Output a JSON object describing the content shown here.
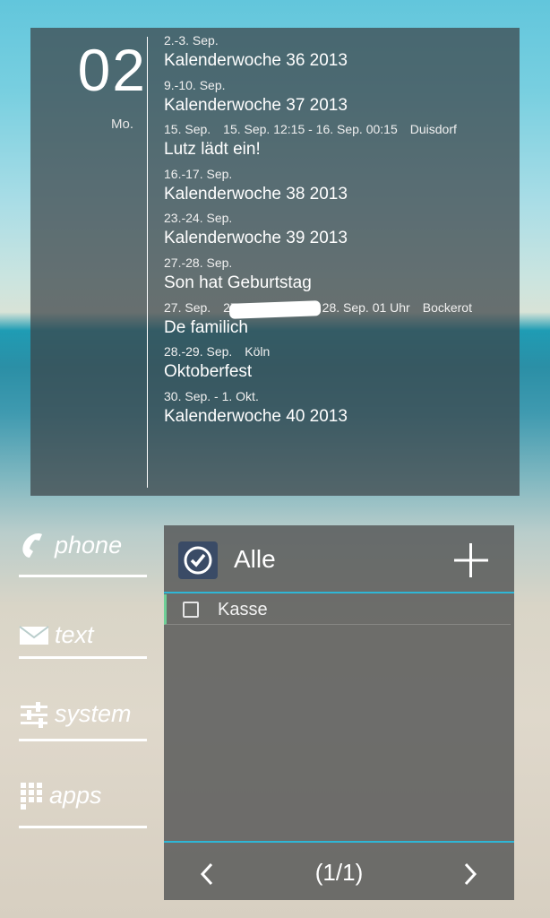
{
  "calendar": {
    "day": "02",
    "weekday": "Mo.",
    "events": [
      {
        "date": [
          "2.-3. Sep."
        ],
        "title": "Kalenderwoche 36 2013"
      },
      {
        "date": [
          "9.-10. Sep."
        ],
        "title": "Kalenderwoche 37 2013"
      },
      {
        "date": [
          "15. Sep.",
          "15. Sep. 12:15 - 16. Sep. 00:15",
          "Duisdorf"
        ],
        "title": "Lutz lädt ein!"
      },
      {
        "date": [
          "16.-17. Sep."
        ],
        "title": "Kalenderwoche 38 2013"
      },
      {
        "date": [
          "23.-24. Sep."
        ],
        "title": "Kalenderwoche 39 2013"
      },
      {
        "date": [
          "27.-28. Sep."
        ],
        "title": "Son hat Geburtstag"
      },
      {
        "date": [
          "27. Sep.",
          "27. Sep. 20 Uhr - 28. Sep. 01 Uhr",
          "Bockerot"
        ],
        "title": "De familich"
      },
      {
        "date": [
          "28.-29. Sep.",
          "Köln"
        ],
        "title": "Oktoberfest"
      },
      {
        "date": [
          "30. Sep. - 1. Okt."
        ],
        "title": "Kalenderwoche 40 2013"
      }
    ]
  },
  "nav": {
    "phone": "phone",
    "text": "text",
    "system": "system",
    "apps": "apps"
  },
  "tasks": {
    "list_title": "Alle",
    "items": [
      {
        "label": "Kasse",
        "checked": false
      }
    ],
    "pager": "(1/1)"
  },
  "colors": {
    "accent": "#2fb6d6",
    "row_marker": "#6fcf97",
    "check_button": "#3a4b66"
  },
  "icons": [
    "phone-icon",
    "envelope-icon",
    "sliders-icon",
    "grid-icon",
    "checkmark-circle-icon",
    "plus-icon",
    "chevron-left-icon",
    "chevron-right-icon"
  ]
}
